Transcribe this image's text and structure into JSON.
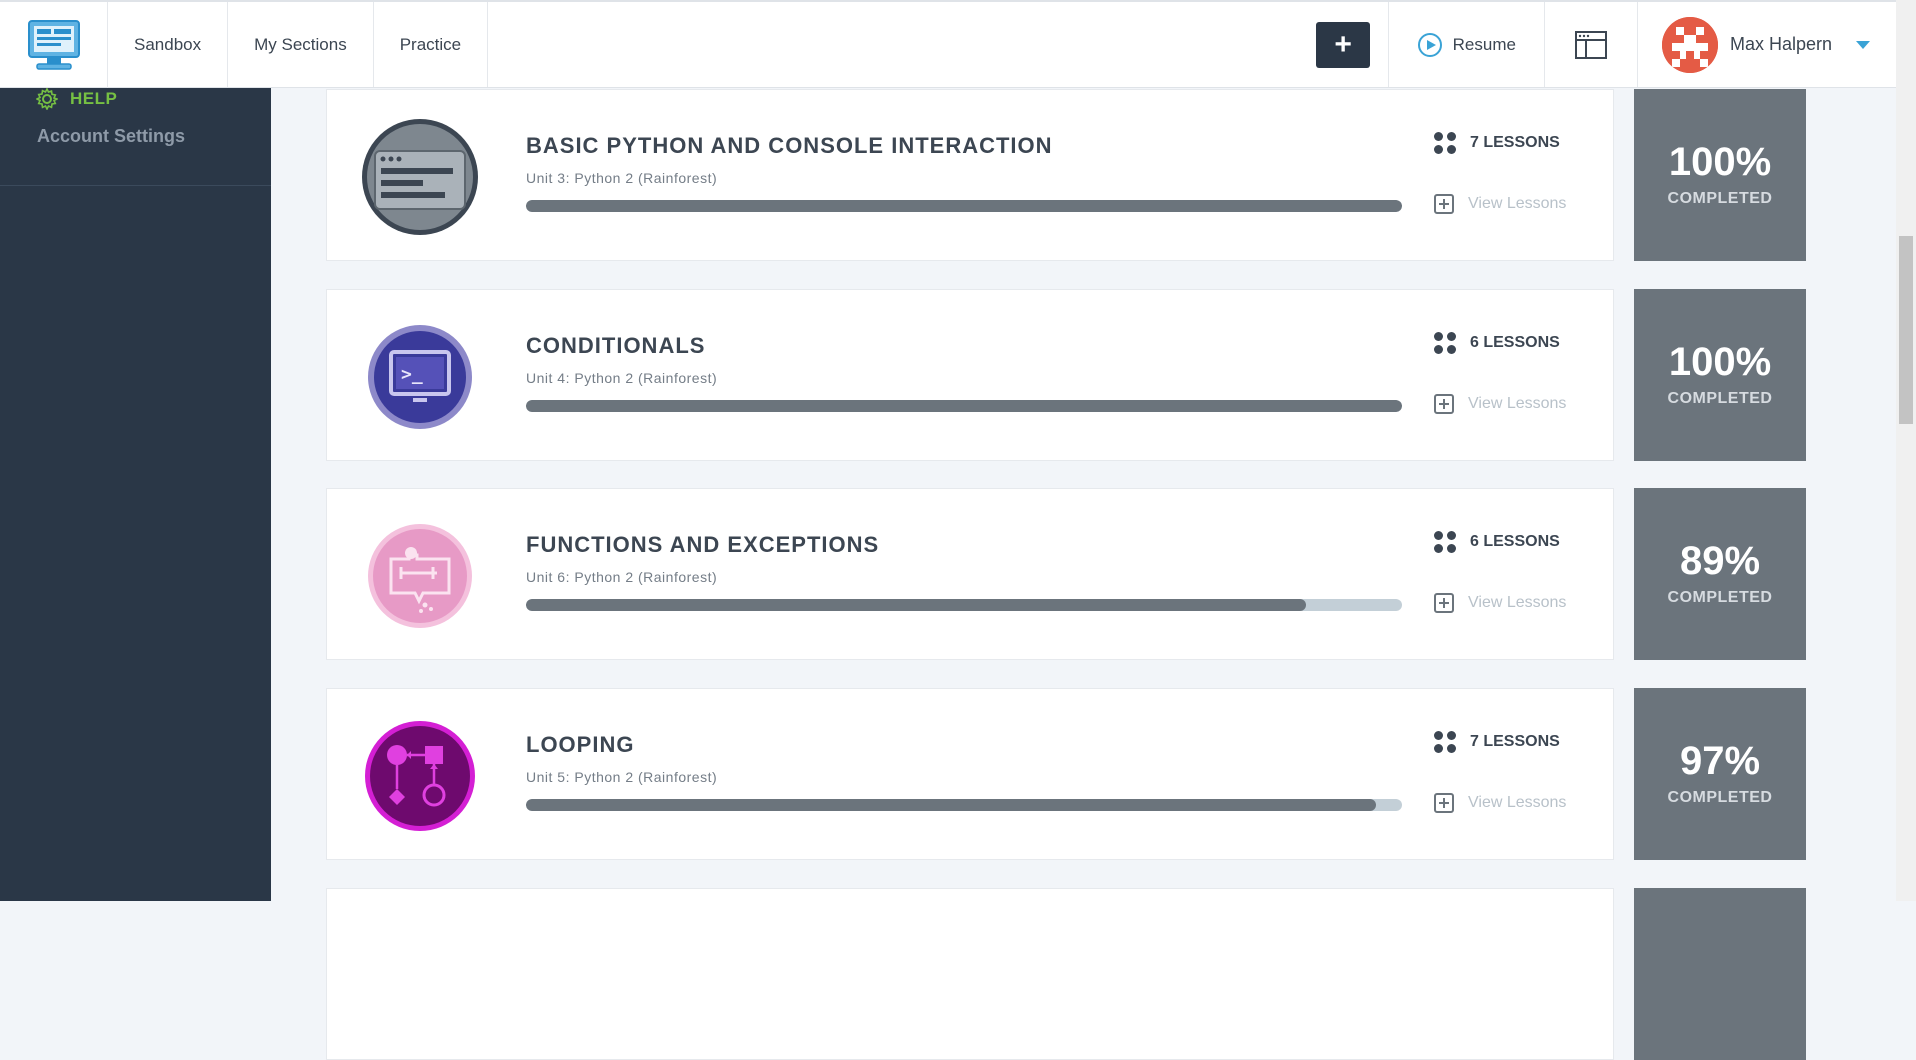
{
  "nav": {
    "items": [
      {
        "label": "Sandbox"
      },
      {
        "label": "My Sections"
      },
      {
        "label": "Practice"
      }
    ],
    "add_label": "+",
    "resume_label": "Resume",
    "user_name": "Max Halpern"
  },
  "sidebar": {
    "help_label": "HELP",
    "account_label": "Account Settings"
  },
  "units": [
    {
      "title": "BASIC PYTHON AND CONSOLE INTERACTION",
      "subtitle": "Unit 3: Python 2 (Rainforest)",
      "lessons": "7 LESSONS",
      "view_label": "View Lessons",
      "percent_label": "100%",
      "completed_label": "COMPLETED",
      "progress": 1.0,
      "icon": "console-icon",
      "icon_color": "#6b747c"
    },
    {
      "title": "CONDITIONALS",
      "subtitle": "Unit 4: Python 2 (Rainforest)",
      "lessons": "6 LESSONS",
      "view_label": "View Lessons",
      "percent_label": "100%",
      "completed_label": "COMPLETED",
      "progress": 1.0,
      "icon": "terminal-monitor-icon",
      "icon_color": "#3a3a9a"
    },
    {
      "title": "FUNCTIONS AND EXCEPTIONS",
      "subtitle": "Unit 6: Python 2 (Rainforest)",
      "lessons": "6 LESSONS",
      "view_label": "View Lessons",
      "percent_label": "89%",
      "completed_label": "COMPLETED",
      "progress": 0.89,
      "icon": "function-machine-icon",
      "icon_color": "#e79ac6"
    },
    {
      "title": "LOOPING",
      "subtitle": "Unit 5: Python 2 (Rainforest)",
      "lessons": "7 LESSONS",
      "view_label": "View Lessons",
      "percent_label": "97%",
      "completed_label": "COMPLETED",
      "progress": 0.97,
      "icon": "flowchart-loop-icon",
      "icon_color": "#7a0a7a"
    }
  ]
}
